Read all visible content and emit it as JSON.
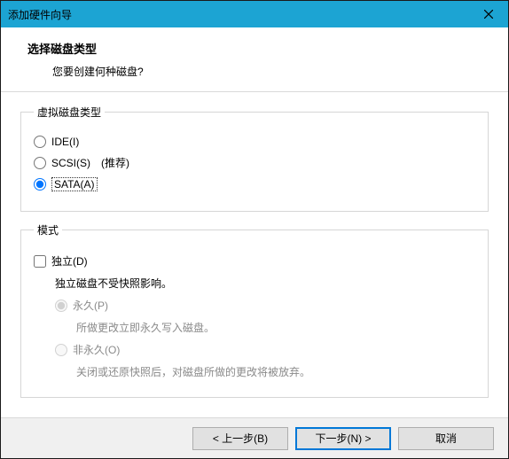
{
  "window": {
    "title": "添加硬件向导"
  },
  "header": {
    "heading": "选择磁盘类型",
    "subheading": "您要创建何种磁盘?"
  },
  "group_disk_type": {
    "legend": "虚拟磁盘类型",
    "options": {
      "ide": "IDE(I)",
      "scsi": "SCSI(S)",
      "scsi_recommend": "(推荐)",
      "sata": "SATA(A)"
    }
  },
  "group_mode": {
    "legend": "模式",
    "independent_label": "独立(D)",
    "independent_hint": "独立磁盘不受快照影响。",
    "options": {
      "persistent_label": "永久(P)",
      "persistent_hint": "所做更改立即永久写入磁盘。",
      "nonpersistent_label": "非永久(O)",
      "nonpersistent_hint": "关闭或还原快照后，对磁盘所做的更改将被放弃。"
    }
  },
  "footer": {
    "back": "< 上一步(B)",
    "next": "下一步(N) >",
    "cancel": "取消"
  }
}
